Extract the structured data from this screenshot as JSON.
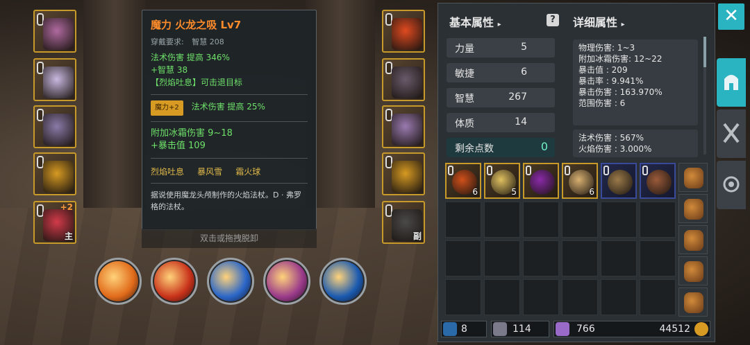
{
  "tooltip": {
    "title": "魔力 火龙之吸 Lv7",
    "req_label": "穿戴要求:",
    "req_value": "智慧 208",
    "line1": "法术伤害 提高 346%",
    "line2": "+智慧 38",
    "line3": "【烈焰吐息】可击退目标",
    "gem_tag": "魔力+2",
    "gem_effect": "法术伤害 提高 25%",
    "bonus1": "附加冰霜伤害 9~18",
    "bonus2": "+暴击值 109",
    "skills": [
      "烈焰吐息",
      "暴风雪",
      "霜火球"
    ],
    "description": "据说使用魔龙头颅制作的火焰法杖。D · 弗罗格的法杖。"
  },
  "unequip_hint": "双击或拖拽脱卸",
  "left_slots": [
    {
      "name": "helmet",
      "color": "#b06aa0"
    },
    {
      "name": "armor",
      "color": "#c8b8e0"
    },
    {
      "name": "legs",
      "color": "#8a7aa8"
    },
    {
      "name": "ring",
      "color": "#d79a22"
    },
    {
      "name": "weapon",
      "color": "#d23a4a",
      "plus": "+2",
      "tag": "主"
    }
  ],
  "right_slots": [
    {
      "name": "amulet",
      "color": "#e04a20"
    },
    {
      "name": "gloves",
      "color": "#6a5a6a"
    },
    {
      "name": "boots",
      "color": "#9a7ab0"
    },
    {
      "name": "ring2",
      "color": "#d79a22"
    },
    {
      "name": "offhand",
      "color": "#4a4a4a",
      "tag": "副"
    }
  ],
  "skills": [
    {
      "name": "meteor",
      "color": "#e06a1a"
    },
    {
      "name": "firestorm",
      "color": "#c8321a"
    },
    {
      "name": "ice-shards",
      "color": "#2a66c8"
    },
    {
      "name": "frostfire-ball",
      "color": "#9a3a8a"
    },
    {
      "name": "dash",
      "color": "#1a5ab0"
    }
  ],
  "panel": {
    "basic_header": "基本属性",
    "detail_header": "详细属性",
    "help_glyph": "?",
    "stats": [
      {
        "label": "力量",
        "value": "5"
      },
      {
        "label": "敏捷",
        "value": "6"
      },
      {
        "label": "智慧",
        "value": "267"
      },
      {
        "label": "体质",
        "value": "14"
      }
    ],
    "free_points_label": "剩余点数",
    "free_points_value": "0",
    "details1": [
      "物理伤害: 1~3",
      "附加冰霜伤害: 12~22",
      "暴击值 : 209",
      "暴击率 : 9.941%",
      "暴击伤害 : 163.970%",
      "范围伤害 : 6"
    ],
    "details2": [
      "法术伤害 : 567%",
      "火焰伤害 : 3.000%"
    ]
  },
  "inventory": {
    "items": [
      {
        "kind": "gold",
        "color": "#d0501a",
        "count": "6"
      },
      {
        "kind": "gold",
        "color": "#e0c060",
        "count": "5"
      },
      {
        "kind": "gold",
        "color": "#8a2aa8",
        "count": ""
      },
      {
        "kind": "gold",
        "color": "#d8b070",
        "count": "6"
      },
      {
        "kind": "blue",
        "color": "#9a7a4a",
        "count": ""
      },
      {
        "kind": "blue",
        "color": "#9a5a3a",
        "count": ""
      }
    ],
    "bags": [
      "bag-1",
      "bag-2",
      "bag-3",
      "bag-4",
      "bag-5"
    ]
  },
  "currency": {
    "skill_points": "8",
    "gems": "114",
    "crystals": "766",
    "gold": "44512"
  },
  "close_glyph": "✕"
}
